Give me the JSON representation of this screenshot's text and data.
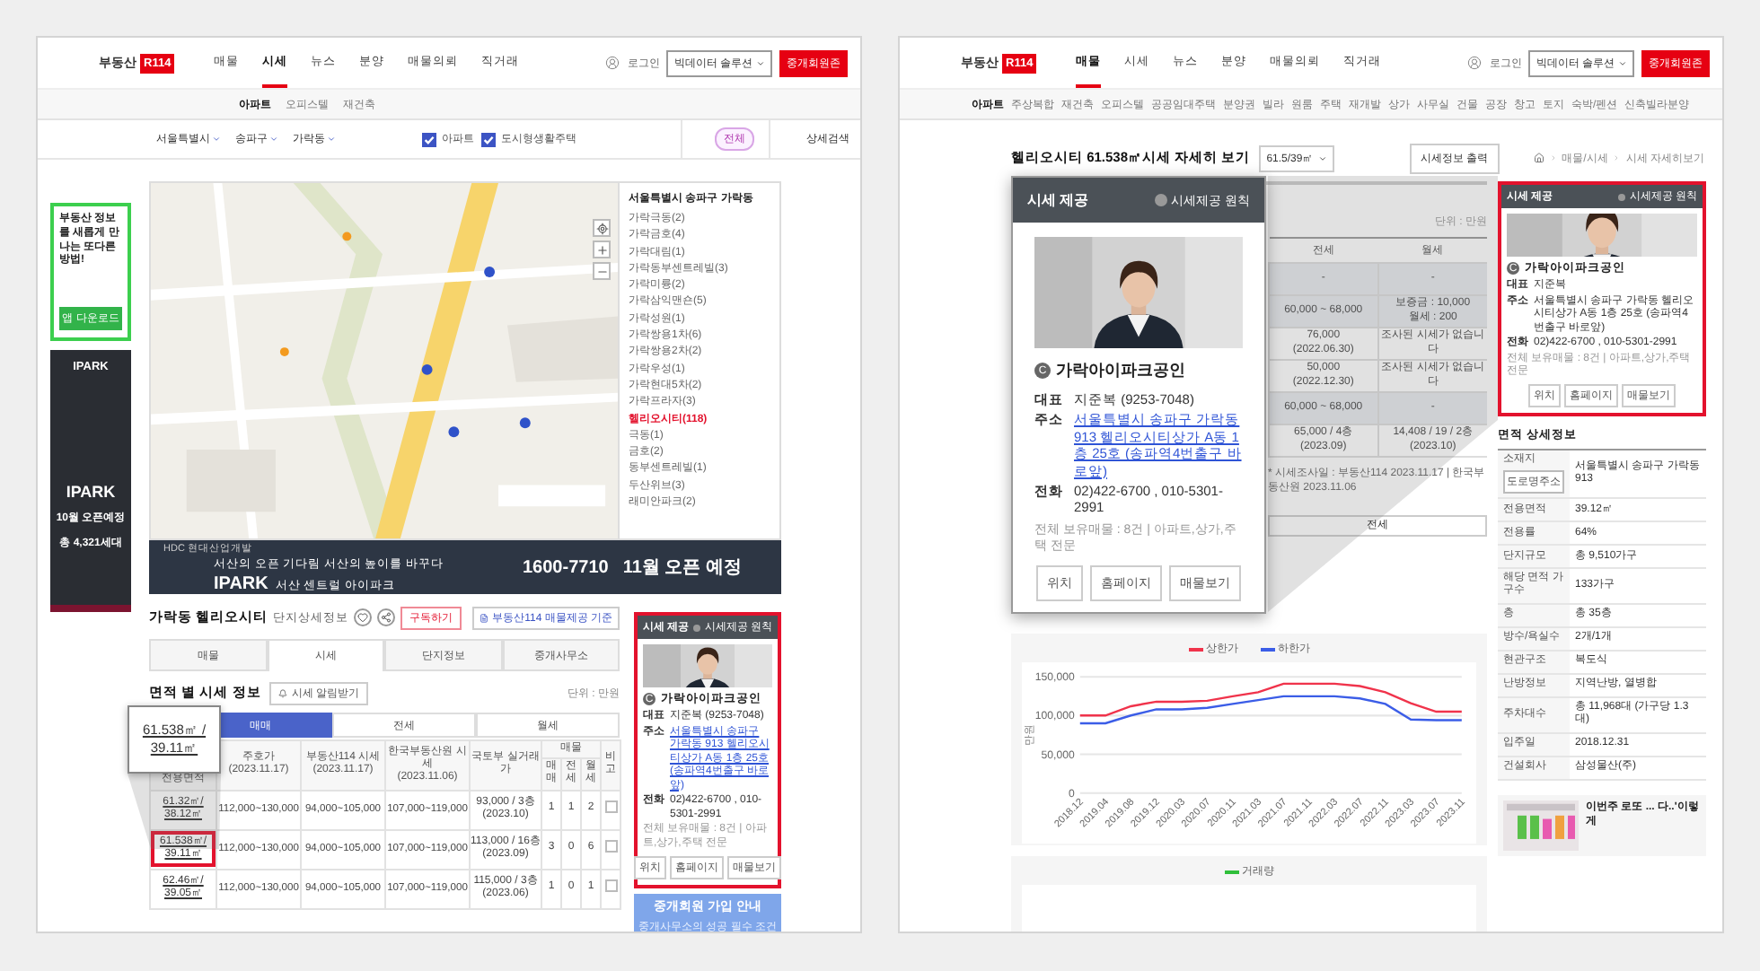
{
  "left_page": {
    "header": {
      "logo_text": "부동산",
      "logo_badge": "R114",
      "nav": [
        {
          "label": "매물",
          "selected": false
        },
        {
          "label": "시세",
          "selected": true
        },
        {
          "label": "뉴스",
          "selected": false
        },
        {
          "label": "분양",
          "selected": false
        },
        {
          "label": "매물의뢰",
          "selected": false
        },
        {
          "label": "직거래",
          "selected": false
        }
      ],
      "login": "로그인",
      "solution_menu": "빅데이터 솔루션",
      "member_button": "중개회원존"
    },
    "subnav": [
      {
        "label": "아파트",
        "selected": true
      },
      {
        "label": "오피스텔",
        "selected": false
      },
      {
        "label": "재건축",
        "selected": false
      }
    ],
    "filters": {
      "regions": [
        "서울특별시",
        "송파구",
        "가락동"
      ],
      "types": [
        {
          "label": "아파트",
          "checked": true
        },
        {
          "label": "도시형생활주택",
          "checked": true
        }
      ],
      "scope": "전체",
      "detail": "상세검색"
    },
    "app_ad": {
      "text": "부동산 정보를 새롭게 만나는 또다른 방법!",
      "button": "앱 다운로드"
    },
    "ipark_ad": {
      "brands": [
        "IPARK",
        "IPARK"
      ],
      "lines": [
        "10월 오픈예정",
        "총 4,321세대"
      ]
    },
    "map_list": {
      "title": "서울특별시 송파구 가락동",
      "items": [
        {
          "label": "가락극동(2)",
          "selected": false
        },
        {
          "label": "가락금호(4)",
          "selected": false
        },
        {
          "label": "가락대림(1)",
          "selected": false
        },
        {
          "label": "가락동부센트레빌(3)",
          "selected": false
        },
        {
          "label": "가락미륭(2)",
          "selected": false
        },
        {
          "label": "가락삼익맨숀(5)",
          "selected": false
        },
        {
          "label": "가락성원(1)",
          "selected": false
        },
        {
          "label": "가락쌍용1차(6)",
          "selected": false
        },
        {
          "label": "가락쌍용2차(2)",
          "selected": false
        },
        {
          "label": "가락우성(1)",
          "selected": false
        },
        {
          "label": "가락현대5차(2)",
          "selected": false
        },
        {
          "label": "가락프라자(3)",
          "selected": false
        },
        {
          "label": "헬리오시티(118)",
          "selected": true
        },
        {
          "label": "극동(1)",
          "selected": false
        },
        {
          "label": "금호(2)",
          "selected": false
        },
        {
          "label": "동부센트레빌(1)",
          "selected": false
        },
        {
          "label": "두산위브(3)",
          "selected": false
        },
        {
          "label": "래미안파크(2)",
          "selected": false
        }
      ]
    },
    "banner": {
      "sponsor": "HDC 현대산업개발",
      "headline": "서산의 오픈 기다림 서산의 높이를 바꾸다",
      "brand": "IPARK",
      "name": "서산 센트럴 아이파크",
      "phone": "1600-7710",
      "open": "11월 오픈 예정"
    },
    "complex": {
      "name": "가락동 헬리오시티",
      "subtitle": "단지상세정보",
      "subscribe": "구독하기",
      "source": "부동산114 매물제공 기준"
    },
    "tabs": [
      {
        "label": "매물",
        "selected": false
      },
      {
        "label": "시세",
        "selected": true
      },
      {
        "label": "단지정보",
        "selected": false
      },
      {
        "label": "중개사무소",
        "selected": false
      }
    ],
    "section": {
      "title": "면적 별 시세 정보",
      "alert_button": "시세 알림받기",
      "unit": "단위 : 만원"
    },
    "deal_tabs": [
      {
        "label": "매매",
        "selected": true
      },
      {
        "label": "전세",
        "selected": false
      },
      {
        "label": "월세",
        "selected": false
      }
    ],
    "table": {
      "columns": [
        {
          "label": "전용면적"
        },
        {
          "label": "주호가",
          "date": "(2023.11.17)"
        },
        {
          "label": "부동산114 시세",
          "date": "(2023.11.17)"
        },
        {
          "label": "한국부동산원 시세",
          "date": "(2023.11.06)"
        },
        {
          "label": "국토부 실거래가"
        }
      ],
      "listing_header": "매물",
      "listing_columns": [
        "매매",
        "전세",
        "월세"
      ],
      "remark": "비고",
      "rows": [
        {
          "area": "61.32㎡/ 38.12㎡",
          "asking": "112,000~130,000",
          "r114": "94,000~105,000",
          "kab": "107,000~119,000",
          "actual": [
            "93,000 / 3층",
            "(2023.10)"
          ],
          "counts": [
            "1",
            "1",
            "2"
          ],
          "checked": false,
          "highlighted": false
        },
        {
          "area": "61.538㎡/ 39.11㎡",
          "asking": "112,000~130,000",
          "r114": "94,000~105,000",
          "kab": "107,000~119,000",
          "actual": [
            "113,000 / 16층",
            "(2023.09)"
          ],
          "counts": [
            "3",
            "0",
            "6"
          ],
          "checked": false,
          "highlighted": true
        },
        {
          "area": "62.46㎡/ 39.05㎡",
          "asking": "112,000~130,000",
          "r114": "94,000~105,000",
          "kab": "107,000~119,000",
          "actual": [
            "115,000 / 3층",
            "(2023.06)"
          ],
          "counts": [
            "1",
            "0",
            "1"
          ],
          "checked": false,
          "highlighted": false
        }
      ]
    },
    "zoom_callout": [
      "61.538㎡ /",
      "39.11㎡"
    ],
    "agent_card": {
      "title": "시세 제공",
      "policy": "시세제공 원칙",
      "badge": "C",
      "name": "가락아이파크공인",
      "rows": [
        {
          "label": "대표",
          "value": "지준복 (9253-7048)",
          "linked": false
        },
        {
          "label": "주소",
          "value": "서울특별시 송파구 가락동 913 헬리오시티상가 A동 1층 25호 (송파역4번출구 바로앞)",
          "linked": true
        },
        {
          "label": "전화",
          "value": "02)422-6700 , 010-5301-2991",
          "linked": false
        }
      ],
      "note": "전체 보유매물 : 8건 | 아파트,상가,주택 전문",
      "buttons": [
        "위치",
        "홈페이지",
        "매물보기"
      ]
    },
    "signup_ad": {
      "title": "중개회원 가입 안내",
      "subtitle": "중개사무소의 성공 필수 조건"
    }
  },
  "right_page": {
    "header": {
      "logo_text": "부동산",
      "logo_badge": "R114",
      "nav": [
        {
          "label": "매물",
          "selected": true
        },
        {
          "label": "시세",
          "selected": false
        },
        {
          "label": "뉴스",
          "selected": false
        },
        {
          "label": "분양",
          "selected": false
        },
        {
          "label": "매물의뢰",
          "selected": false
        },
        {
          "label": "직거래",
          "selected": false
        }
      ],
      "login": "로그인",
      "solution_menu": "빅데이터 솔루션",
      "member_button": "중개회원존"
    },
    "subnav": [
      {
        "label": "아파트",
        "selected": true
      },
      {
        "label": "주상복합",
        "selected": false
      },
      {
        "label": "재건축",
        "selected": false
      },
      {
        "label": "오피스텔",
        "selected": false
      },
      {
        "label": "공공임대주택",
        "selected": false
      },
      {
        "label": "분양권",
        "selected": false
      },
      {
        "label": "빌라",
        "selected": false
      },
      {
        "label": "원룸",
        "selected": false
      },
      {
        "label": "주택",
        "selected": false
      },
      {
        "label": "재개발",
        "selected": false
      },
      {
        "label": "상가",
        "selected": false
      },
      {
        "label": "사무실",
        "selected": false
      },
      {
        "label": "건물",
        "selected": false
      },
      {
        "label": "공장",
        "selected": false
      },
      {
        "label": "창고",
        "selected": false
      },
      {
        "label": "토지",
        "selected": false
      },
      {
        "label": "숙박/펜션",
        "selected": false
      },
      {
        "label": "신축빌라분양",
        "selected": false
      }
    ],
    "title": "헬리오시티 61.538㎡시세 자세히 보기",
    "area_select": "61.5/39㎡",
    "print_button": "시세정보 출력",
    "breadcrumb": [
      "매물/시세",
      "시세 자세히보기"
    ],
    "price_table": {
      "unit": "단위 : 만원",
      "columns": [
        "전세",
        "월세"
      ],
      "rows": [
        {
          "cells": [
            [
              "-"
            ],
            [
              "-"
            ]
          ],
          "shaded": true
        },
        {
          "cells": [
            [
              "60,000 ~ 68,000"
            ],
            [
              "보증금 : 10,000",
              "월세 : 200"
            ]
          ],
          "shaded": true
        },
        {
          "cells": [
            [
              "76,000",
              "(2022.06.30)"
            ],
            [
              "조사된 시세가 없습니다"
            ]
          ],
          "shaded": false
        },
        {
          "cells": [
            [
              "50,000",
              "(2022.12.30)"
            ],
            [
              "조사된 시세가 없습니다"
            ]
          ],
          "shaded": false
        },
        {
          "cells": [
            [
              "60,000 ~ 68,000"
            ],
            [
              "-"
            ]
          ],
          "shaded": true
        },
        {
          "cells": [
            [
              "65,000 / 4층",
              "(2023.09)"
            ],
            [
              "14,408 / 19 / 2층",
              "(2023.10)"
            ]
          ],
          "shaded": false
        }
      ],
      "footnote": "* 시세조사일 : 부동산114 2023.11.17 | 한국부동산원 2023.11.06",
      "deal_tab": "전세"
    },
    "agent_callout": {
      "title": "시세 제공",
      "policy": "시세제공 원칙",
      "badge": "C",
      "name": "가락아이파크공인",
      "rows": [
        {
          "label": "대표",
          "value": "지준복 (9253-7048)",
          "linked": false
        },
        {
          "label": "주소",
          "value": "서울특별시 송파구 가락동 913 헬리오시티상가 A동 1층 25호 (송파역4번출구 바로앞)",
          "linked": true
        },
        {
          "label": "전화",
          "value": "02)422-6700 , 010-5301-2991",
          "linked": false
        }
      ],
      "note": "전체 보유매물 : 8건 | 아파트,상가,주택 전문",
      "buttons": [
        "위치",
        "홈페이지",
        "매물보기"
      ]
    },
    "agent_card": {
      "title": "시세 제공",
      "policy": "시세제공 원칙",
      "badge": "C",
      "name": "가락아이파크공인",
      "rows": [
        {
          "label": "대표",
          "value": "지준복",
          "linked": false
        },
        {
          "label": "주소",
          "value": "서울특별시 송파구 가락동 헬리오시티상가 A동 1층 25호 (송파역4번출구 바로앞)",
          "linked": false
        },
        {
          "label": "전화",
          "value": "02)422-6700 , 010-5301-2991",
          "linked": false
        }
      ],
      "note": "전체 보유매물 : 8건 | 아파트,상가,주택 전문",
      "buttons": [
        "위치",
        "홈페이지",
        "매물보기"
      ]
    },
    "price_chart": {
      "chart_data": {
        "type": "line",
        "ylabel": "만원",
        "categories": [
          "2018.12",
          "2019.04",
          "2019.08",
          "2019.12",
          "2020.03",
          "2020.07",
          "2020.11",
          "2021.03",
          "2021.07",
          "2021.11",
          "2022.03",
          "2022.07",
          "2022.11",
          "2023.03",
          "2023.07",
          "2023.11"
        ],
        "yticks": [
          0,
          {
            "value": 50000,
            "label": "50,000"
          },
          {
            "value": 100000,
            "label": "100,000"
          },
          {
            "value": 150000,
            "label": "150,000"
          }
        ],
        "ylim": [
          0,
          150000
        ],
        "series": [
          {
            "name": "상한가",
            "color": "#f0334b",
            "values": [
              100000,
              100000,
              112000,
              118000,
              118000,
              119000,
              125000,
              130000,
              141000,
              141000,
              141000,
              138000,
              130000,
              116000,
              105000,
              105000
            ]
          },
          {
            "name": "하한가",
            "color": "#3b5de7",
            "values": [
              90000,
              90000,
              100000,
              108000,
              108000,
              110000,
              115000,
              120000,
              125000,
              125000,
              125000,
              122000,
              115000,
              95000,
              94000,
              94000
            ]
          }
        ]
      }
    },
    "volume_chart": {
      "legend": "거래량"
    },
    "details": {
      "title": "면적 상세정보",
      "address_button": "도로명주소",
      "rows": [
        {
          "label": "소재지",
          "value": "서울특별시 송파구 가락동 913"
        },
        {
          "label": "전용면적",
          "value": "39.12㎡"
        },
        {
          "label": "전용률",
          "value": "64%"
        },
        {
          "label": "단지규모",
          "value": "총 9,510가구"
        },
        {
          "label": "해당 면적 가구수",
          "value": "133가구"
        },
        {
          "label": "층",
          "value": "총 35층"
        },
        {
          "label": "방수/욕실수",
          "value": "2개/1개"
        },
        {
          "label": "현관구조",
          "value": "복도식"
        },
        {
          "label": "난방정보",
          "value": "지역난방, 열병합"
        },
        {
          "label": "주차대수",
          "value": "총 11,968대 (가구당 1.3대)"
        },
        {
          "label": "입주일",
          "value": "2018.12.31"
        },
        {
          "label": "건설회사",
          "value": "삼성물산(주)"
        }
      ]
    },
    "news_ad": {
      "text": "이번주 로또 ... 다..'이렇게"
    }
  }
}
